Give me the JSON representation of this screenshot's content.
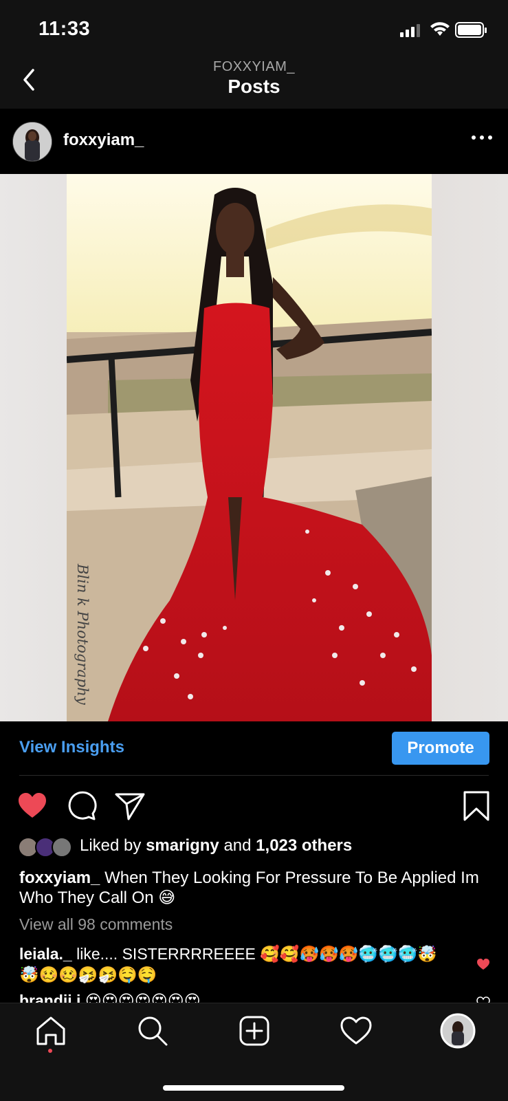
{
  "status_bar": {
    "time": "11:33"
  },
  "header": {
    "account_label": "FOXXYIAM_",
    "title": "Posts"
  },
  "post": {
    "username": "foxxyiam_",
    "photo_watermark": "Blin k Photography",
    "insights_label": "View Insights",
    "promote_label": "Promote",
    "liked": true,
    "likes": {
      "prefix": "Liked by",
      "user": "smarigny",
      "and": "and",
      "others": "1,023 others"
    },
    "caption": {
      "user": "foxxyiam_",
      "text": "When They Looking For Pressure To Be Applied Im Who They Call On 😅"
    },
    "view_all_comments": "View all 98 comments",
    "comments": [
      {
        "user": "leiala._",
        "text": "like.... SISTERRRREEEE 🥰🥰🥵🥵🥵🥶🥶🥶🤯🤯🥴🥴🤧🤧🤤🤤",
        "liked": true
      },
      {
        "user": "brandii.i",
        "text": "😍😍😍😍😍😍😍",
        "liked": false
      }
    ]
  },
  "tabbar": {
    "items": [
      "home",
      "search",
      "new-post",
      "activity",
      "profile"
    ],
    "active": "home"
  },
  "colors": {
    "accent": "#3897f0",
    "like": "#ed4956",
    "background": "#000000"
  }
}
